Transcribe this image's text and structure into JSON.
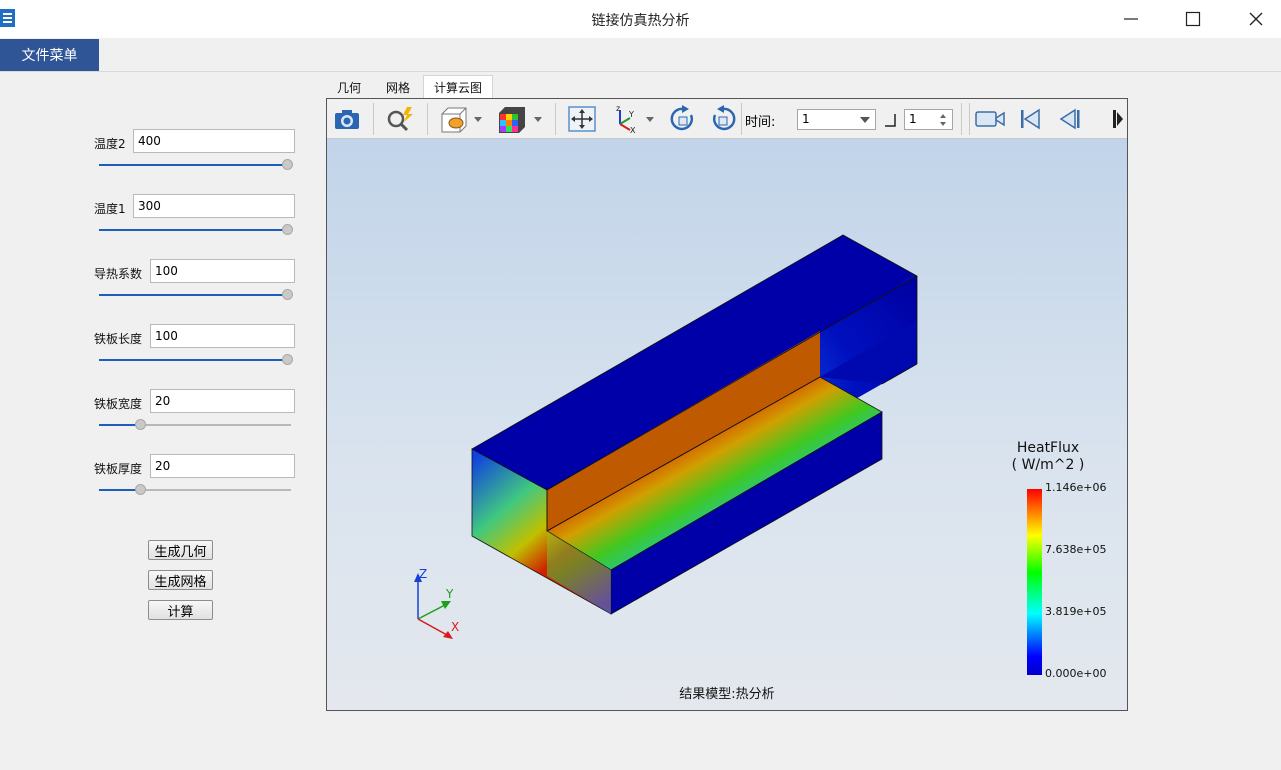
{
  "window": {
    "title": "链接仿真热分析",
    "min_icon": "minimize-icon",
    "max_icon": "maximize-icon",
    "close_icon": "close-icon"
  },
  "menu": {
    "file_menu": "文件菜单"
  },
  "params": [
    {
      "label": "温度2",
      "value": "400",
      "slider_fraction": 1.0
    },
    {
      "label": "温度1",
      "value": "300",
      "slider_fraction": 1.0
    },
    {
      "label": "导热系数",
      "value": "100",
      "slider_fraction": 1.0
    },
    {
      "label": "铁板长度",
      "value": "100",
      "slider_fraction": 1.0
    },
    {
      "label": "铁板宽度",
      "value": "20",
      "slider_fraction": 0.2
    },
    {
      "label": "铁板厚度",
      "value": "20",
      "slider_fraction": 0.2
    }
  ],
  "actions": {
    "gen_geometry": "生成几何",
    "gen_mesh": "生成网格",
    "compute": "计算"
  },
  "tabs": [
    {
      "label": "几何",
      "active": false
    },
    {
      "label": "网格",
      "active": false
    },
    {
      "label": "计算云图",
      "active": true
    }
  ],
  "toolbar": {
    "icons": [
      "camera-icon",
      "zoom-icon",
      "surface-display-icon",
      "color-cube-icon",
      "fit-view-icon",
      "axes-icon",
      "rotate-cw-icon",
      "rotate-ccw-icon",
      "video-camera-icon",
      "first-frame-icon",
      "previous-frame-icon",
      "next-frame-icon"
    ],
    "time_label": "时间:",
    "time_value": "1",
    "step_value": "1"
  },
  "viewer": {
    "colorbar_title_line1": "HeatFlux",
    "colorbar_title_line2": "( W/m^2 )",
    "colorbar_labels": [
      "1.146e+06",
      "7.638e+05",
      "3.819e+05",
      "0.000e+00"
    ],
    "colorbar_colors": [
      "#ff0000",
      "#ffff00",
      "#00ff00",
      "#00ffff",
      "#0000ff"
    ],
    "axis_labels": {
      "z": "Z",
      "y": "Y",
      "x": "X"
    },
    "result_label": "结果模型:热分析"
  }
}
